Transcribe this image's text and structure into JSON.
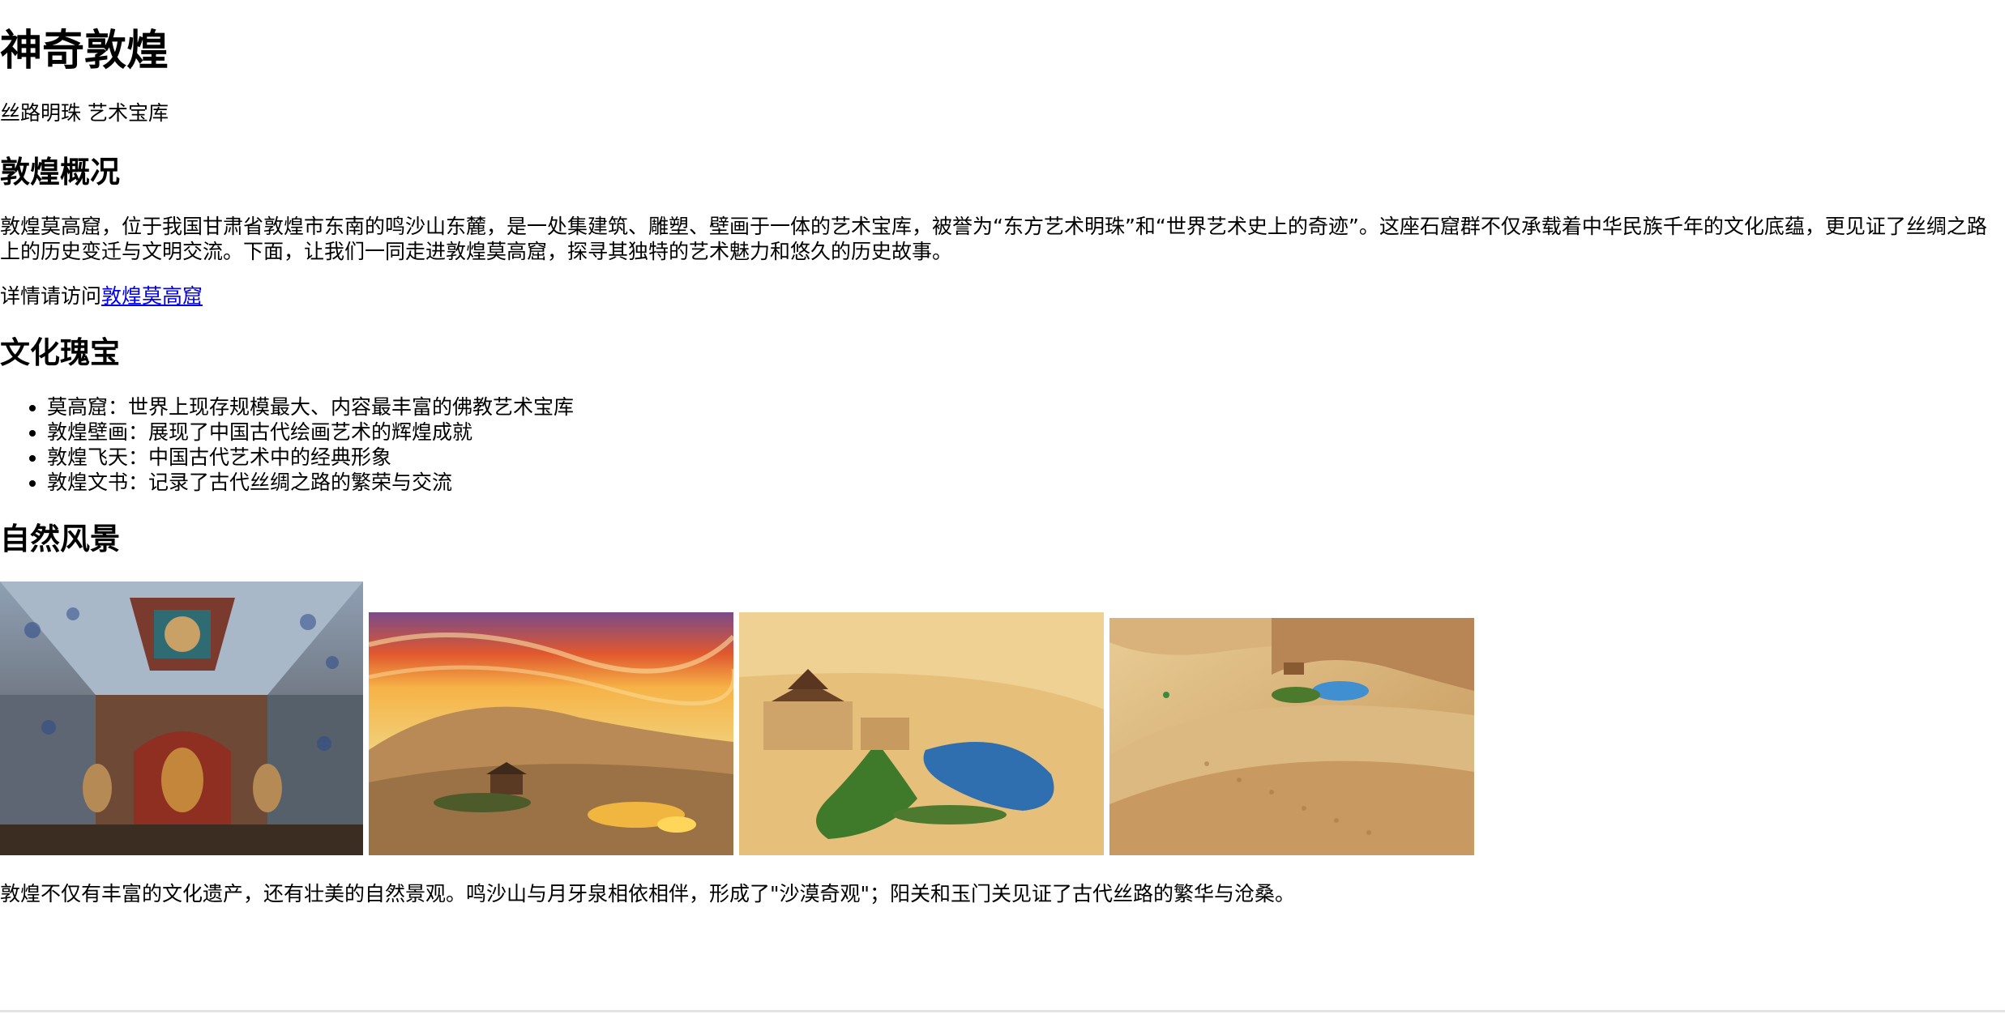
{
  "header": {
    "title": "神奇敦煌",
    "subtitle": "丝路明珠 艺术宝库"
  },
  "overview": {
    "heading": "敦煌概况",
    "text": "敦煌莫高窟，位于我国甘肃省敦煌市东南的鸣沙山东麓，是一处集建筑、雕塑、壁画于一体的艺术宝库，被誉为“东方艺术明珠”和“世界艺术史上的奇迹”。这座石窟群不仅承载着中华民族千年的文化底蕴，更见证了丝绸之路上的历史变迁与文明交流。下面，让我们一同走进敦煌莫高窟，探寻其独特的艺术魅力和悠久的历史故事。",
    "link_prefix": "详情请访问",
    "link_label": "敦煌莫高窟"
  },
  "culture": {
    "heading": "文化瑰宝",
    "items": [
      "莫高窟：世界上现存规模最大、内容最丰富的佛教艺术宝库",
      "敦煌壁画：展现了中国古代绘画艺术的辉煌成就",
      "敦煌飞天：中国古代艺术中的经典形象",
      "敦煌文书：记录了古代丝绸之路的繁荣与交流"
    ]
  },
  "nature": {
    "heading": "自然风景",
    "photos": [
      {
        "subject": "mogao-cave-interior-photo"
      },
      {
        "subject": "desert-sunset-oasis-photo"
      },
      {
        "subject": "crescent-lake-aerial-photo"
      },
      {
        "subject": "sand-dune-lake-photo"
      }
    ],
    "text": "敦煌不仅有丰富的文化遗产，还有壮美的自然景观。鸣沙山与月牙泉相依相伴，形成了\"沙漠奇观\"；阳关和玉门关见证了古代丝路的繁华与沧桑。"
  },
  "colors": {
    "link": "#0000ee",
    "text": "#000000",
    "background": "#ffffff"
  }
}
